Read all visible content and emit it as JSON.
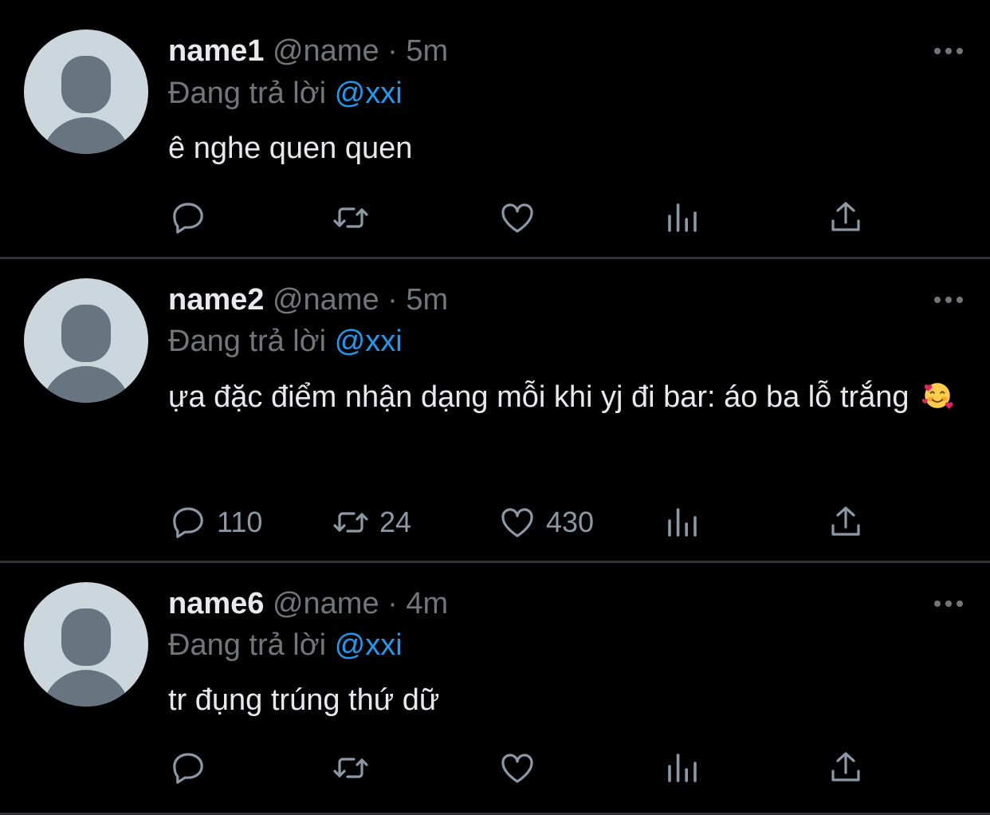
{
  "colors": {
    "background": "#000000",
    "divider": "#2f3336",
    "text_primary": "#e7e9ea",
    "text_secondary": "#71767b",
    "mention": "#1d9bf0",
    "avatar_bg": "#ccd6dd",
    "avatar_fg": "#66757f"
  },
  "icons": {
    "reply": "chat-bubble-icon",
    "retweet": "retweet-icon",
    "like": "heart-icon",
    "views": "bar-chart-icon",
    "share": "share-upload-icon",
    "more": "more-dots-icon",
    "avatar": "default-avatar-icon"
  },
  "tweets": [
    {
      "display_name": "name1",
      "handle": "@name",
      "separator": "·",
      "time": "5m",
      "reply_prefix": "Đang trả lời",
      "reply_to": "@xxi",
      "text": "ê nghe quen quen",
      "emoji": "",
      "counts": {
        "reply": "",
        "retweet": "",
        "like": ""
      }
    },
    {
      "display_name": "name2",
      "handle": "@name",
      "separator": "·",
      "time": "5m",
      "reply_prefix": "Đang trả lời",
      "reply_to": "@xxi",
      "text": "ựa đặc điểm nhận dạng mỗi khi yj đi bar: áo ba lỗ trắng",
      "emoji": "🥰",
      "counts": {
        "reply": "110",
        "retweet": "24",
        "like": "430"
      }
    },
    {
      "display_name": "name6",
      "handle": "@name",
      "separator": "·",
      "time": "4m",
      "reply_prefix": "Đang trả lời",
      "reply_to": "@xxi",
      "text": "tr đụng trúng thứ dữ",
      "emoji": "",
      "counts": {
        "reply": "",
        "retweet": "",
        "like": ""
      }
    }
  ]
}
